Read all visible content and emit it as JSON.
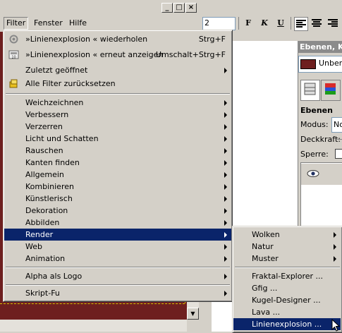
{
  "menubar": {
    "items": [
      "Filter",
      "Fenster",
      "Hilfe"
    ]
  },
  "window_buttons": {
    "minimize": "_",
    "maximize": "□",
    "close": "×"
  },
  "toolbar": {
    "size_value": "2",
    "bold": "F",
    "italic": "K",
    "underline": "U"
  },
  "dock": {
    "title": "Ebenen, Ka",
    "image_name": "Unbenan",
    "layers_label": "Ebenen",
    "modus_label": "Modus:",
    "modus_value": "No",
    "deckkraft_label": "Deckkraft:",
    "sperre_label": "Sperre:"
  },
  "filter_menu": {
    "repeat": {
      "label": "»Linienexplosion « wiederholen",
      "shortcut": "Strg+F"
    },
    "reshow": {
      "label": "»Linienexplosion « erneut anzeigen",
      "shortcut": "Umschalt+Strg+F"
    },
    "recent": "Zuletzt geöffnet",
    "reset": "Alle Filter zurücksetzen",
    "categories": [
      "Weichzeichnen",
      "Verbessern",
      "Verzerren",
      "Licht und Schatten",
      "Rauschen",
      "Kanten finden",
      "Allgemein",
      "Kombinieren",
      "Künstlerisch",
      "Dekoration",
      "Abbilden",
      "Render",
      "Web",
      "Animation"
    ],
    "alpha_logo": "Alpha als Logo",
    "script_fu": "Skript-Fu"
  },
  "render_menu": {
    "submenus": [
      "Wolken",
      "Natur",
      "Muster"
    ],
    "items": [
      "Fraktal-Explorer ...",
      "Gfig ...",
      "Kugel-Designer ...",
      "Lava ...",
      "Linienexplosion ..."
    ]
  },
  "colors": {
    "selection": "#0a246a",
    "canvas": "#6e1f1f",
    "menu_bg": "#d4d0c8"
  }
}
